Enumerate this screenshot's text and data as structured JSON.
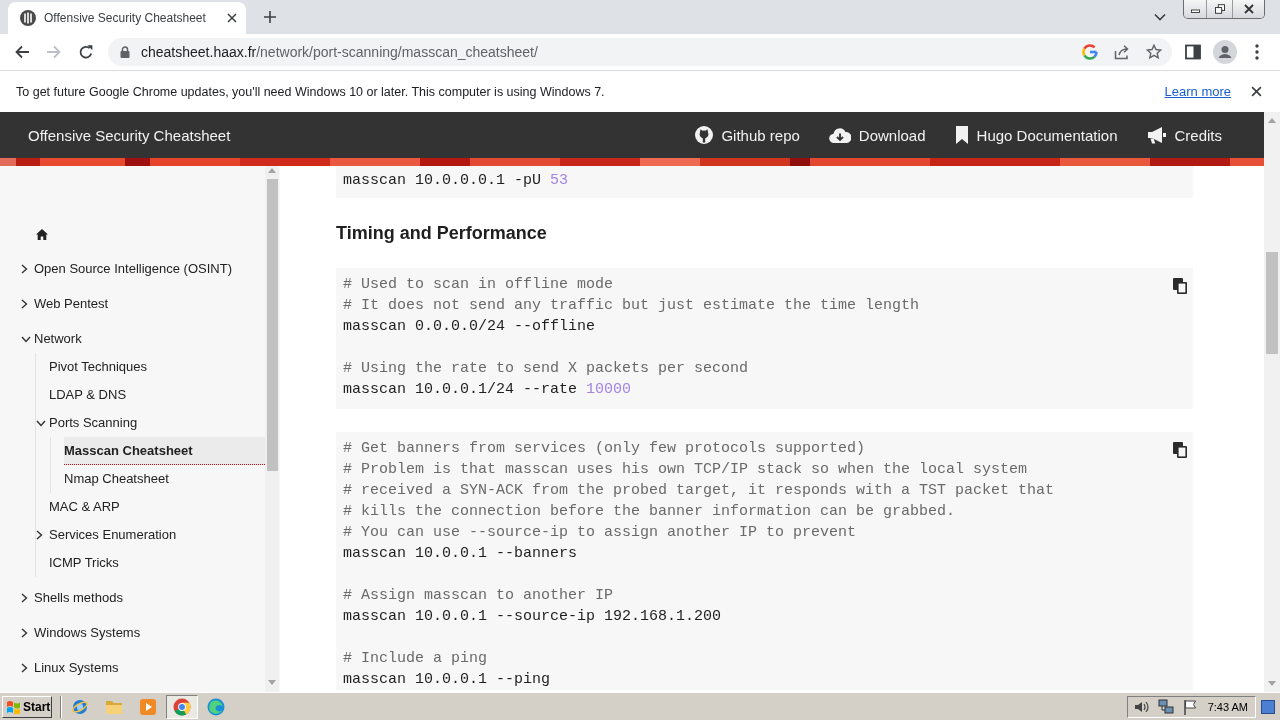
{
  "browser": {
    "tabs": [
      {
        "title": "Offensive Security Cheatsheet",
        "selected": true
      }
    ],
    "back_disabled": false,
    "forward_disabled": true,
    "url_host": "cheatsheet.haax.fr",
    "url_path": "/network/port-scanning/masscan_cheatsheet/"
  },
  "infobar": {
    "message": "To get future Google Chrome updates, you'll need Windows 10 or later. This computer is using Windows 7.",
    "link": "Learn more"
  },
  "site_header": {
    "title": "Offensive Security Cheatsheet",
    "nav": [
      {
        "label": "Github repo"
      },
      {
        "label": "Download"
      },
      {
        "label": "Hugo Documentation"
      },
      {
        "label": "Credits"
      }
    ]
  },
  "sidebar": {
    "items": [
      {
        "kind": "section",
        "label": "Open Source Intelligence (OSINT)",
        "expanded": false,
        "selected": false
      },
      {
        "kind": "section",
        "label": "Web Pentest",
        "expanded": false,
        "selected": false
      },
      {
        "kind": "section",
        "label": "Network",
        "expanded": true,
        "selected": false,
        "children": [
          {
            "kind": "page",
            "label": "Pivot Techniques",
            "selected": false
          },
          {
            "kind": "page",
            "label": "LDAP & DNS",
            "selected": false
          },
          {
            "kind": "section",
            "label": "Ports Scanning",
            "expanded": true,
            "selected": false,
            "children": [
              {
                "kind": "page",
                "label": "Masscan Cheatsheet",
                "selected": true
              },
              {
                "kind": "page",
                "label": "Nmap Cheatsheet",
                "selected": false
              }
            ]
          },
          {
            "kind": "page",
            "label": "MAC & ARP",
            "selected": false
          },
          {
            "kind": "section",
            "label": "Services Enumeration",
            "expanded": false,
            "selected": false
          },
          {
            "kind": "page",
            "label": "ICMP Tricks",
            "selected": false
          }
        ]
      },
      {
        "kind": "section",
        "label": "Shells methods",
        "expanded": false,
        "selected": false
      },
      {
        "kind": "section",
        "label": "Windows Systems",
        "expanded": false,
        "selected": false
      },
      {
        "kind": "section",
        "label": "Linux Systems",
        "expanded": false,
        "selected": false
      }
    ]
  },
  "content": {
    "blocks": [
      {
        "kind": "code",
        "top_cut": true,
        "bottom_cut": false,
        "lines": [
          {
            "kind": "command",
            "tokens": [
              {
                "kind": "plain",
                "text": "masscan 10.0.0.0.1 -pU "
              },
              {
                "kind": "number",
                "text": "53"
              }
            ]
          }
        ]
      },
      {
        "kind": "heading",
        "text": "Timing and Performance"
      },
      {
        "kind": "code",
        "top_cut": false,
        "bottom_cut": false,
        "lines": [
          {
            "kind": "comment",
            "text": "# Used to scan in offline mode"
          },
          {
            "kind": "comment",
            "text": "# It does not send any traffic but just estimate the time length"
          },
          {
            "kind": "command",
            "tokens": [
              {
                "kind": "plain",
                "text": "masscan 0.0.0.0/24 --offline"
              }
            ]
          },
          {
            "kind": "blank"
          },
          {
            "kind": "comment",
            "text": "# Using the rate to send X packets per second"
          },
          {
            "kind": "command",
            "tokens": [
              {
                "kind": "plain",
                "text": "masscan 10.0.0.1/24 --rate "
              },
              {
                "kind": "number",
                "text": "10000"
              }
            ]
          }
        ]
      },
      {
        "kind": "code",
        "top_cut": false,
        "bottom_cut": true,
        "lines": [
          {
            "kind": "comment",
            "text": "# Get banners from services (only few protocols supported)"
          },
          {
            "kind": "comment",
            "text": "# Problem is that masscan uses his own TCP/IP stack so when the local system"
          },
          {
            "kind": "comment",
            "text": "# received a SYN-ACK from the probed target, it responds with a TST packet that"
          },
          {
            "kind": "comment",
            "text": "# kills the connection before the banner information can be grabbed."
          },
          {
            "kind": "comment",
            "text": "# You can use --source-ip to assign another IP to prevent"
          },
          {
            "kind": "command",
            "tokens": [
              {
                "kind": "plain",
                "text": "masscan 10.0.0.1 --banners"
              }
            ]
          },
          {
            "kind": "blank"
          },
          {
            "kind": "comment",
            "text": "# Assign masscan to another IP"
          },
          {
            "kind": "command",
            "tokens": [
              {
                "kind": "plain",
                "text": "masscan 10.0.0.1 --source-ip 192.168.1.200"
              }
            ]
          },
          {
            "kind": "blank"
          },
          {
            "kind": "comment",
            "text": "# Include a ping"
          },
          {
            "kind": "command",
            "tokens": [
              {
                "kind": "plain",
                "text": "masscan 10.0.0.1 --ping"
              }
            ]
          }
        ]
      }
    ]
  },
  "taskbar": {
    "start": "Start",
    "apps": [
      {
        "selected": false
      },
      {
        "selected": false
      },
      {
        "selected": false
      },
      {
        "selected": true
      },
      {
        "selected": false
      }
    ],
    "clock": "7:43 AM"
  }
}
